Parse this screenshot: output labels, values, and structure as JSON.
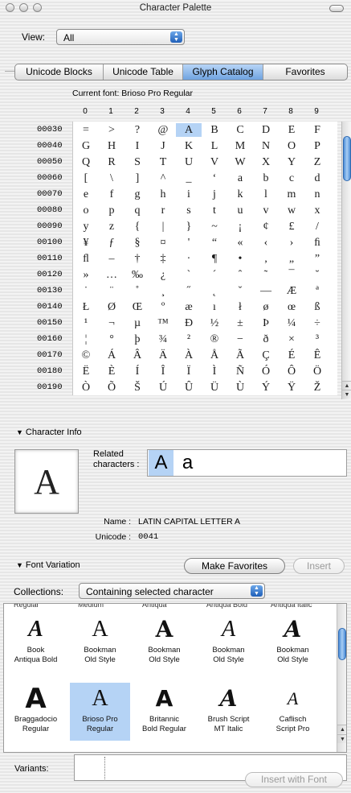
{
  "window": {
    "title": "Character Palette"
  },
  "view": {
    "label": "View:",
    "value": "All"
  },
  "tabs": [
    {
      "label": "Unicode Blocks",
      "active": false
    },
    {
      "label": "Unicode Table",
      "active": false
    },
    {
      "label": "Glyph Catalog",
      "active": true
    },
    {
      "label": "Favorites",
      "active": false
    }
  ],
  "glyph_table": {
    "current_font_label": "Current font:",
    "current_font": "Brioso Pro Regular",
    "columns": [
      "0",
      "1",
      "2",
      "3",
      "4",
      "5",
      "6",
      "7",
      "8",
      "9"
    ],
    "selected": {
      "row": 0,
      "col": 4
    },
    "rows": [
      {
        "code": "00030",
        "glyphs": [
          "=",
          ">",
          "?",
          "@",
          "A",
          "B",
          "C",
          "D",
          "E",
          "F"
        ]
      },
      {
        "code": "00040",
        "glyphs": [
          "G",
          "H",
          "I",
          "J",
          "K",
          "L",
          "M",
          "N",
          "O",
          "P"
        ]
      },
      {
        "code": "00050",
        "glyphs": [
          "Q",
          "R",
          "S",
          "T",
          "U",
          "V",
          "W",
          "X",
          "Y",
          "Z"
        ]
      },
      {
        "code": "00060",
        "glyphs": [
          "[",
          "\\",
          "]",
          "^",
          "_",
          "‘",
          "a",
          "b",
          "c",
          "d"
        ]
      },
      {
        "code": "00070",
        "glyphs": [
          "e",
          "f",
          "g",
          "h",
          "i",
          "j",
          "k",
          "l",
          "m",
          "n"
        ]
      },
      {
        "code": "00080",
        "glyphs": [
          "o",
          "p",
          "q",
          "r",
          "s",
          "t",
          "u",
          "v",
          "w",
          "x"
        ]
      },
      {
        "code": "00090",
        "glyphs": [
          "y",
          "z",
          "{",
          "|",
          "}",
          "~",
          "¡",
          "¢",
          "£",
          "/"
        ]
      },
      {
        "code": "00100",
        "glyphs": [
          "¥",
          "ƒ",
          "§",
          "¤",
          "'",
          "“",
          "«",
          "‹",
          "›",
          "ﬁ"
        ]
      },
      {
        "code": "00110",
        "glyphs": [
          "ﬂ",
          "–",
          "†",
          "‡",
          "·",
          "¶",
          "•",
          "‚",
          "„",
          "”"
        ]
      },
      {
        "code": "00120",
        "glyphs": [
          "»",
          "…",
          "‰",
          "¿",
          "`",
          "´",
          "ˆ",
          "˜",
          "¯",
          "˘"
        ]
      },
      {
        "code": "00130",
        "glyphs": [
          "˙",
          "¨",
          "˚",
          "¸",
          "˝",
          "˛",
          "ˇ",
          "—",
          "Æ",
          "ª"
        ]
      },
      {
        "code": "00140",
        "glyphs": [
          "Ł",
          "Ø",
          "Œ",
          "º",
          "æ",
          "ı",
          "ł",
          "ø",
          "œ",
          "ß"
        ]
      },
      {
        "code": "00150",
        "glyphs": [
          "¹",
          "¬",
          "µ",
          "™",
          "Ð",
          "½",
          "±",
          "Þ",
          "¼",
          "÷"
        ]
      },
      {
        "code": "00160",
        "glyphs": [
          "¦",
          "°",
          "þ",
          "¾",
          "²",
          "®",
          "−",
          "ð",
          "×",
          "³"
        ]
      },
      {
        "code": "00170",
        "glyphs": [
          "©",
          "Á",
          "Â",
          "Ä",
          "À",
          "Å",
          "Ã",
          "Ç",
          "É",
          "Ê"
        ]
      },
      {
        "code": "00180",
        "glyphs": [
          "Ë",
          "È",
          "Í",
          "Î",
          "Ï",
          "Ì",
          "Ñ",
          "Ó",
          "Ô",
          "Ö"
        ]
      },
      {
        "code": "00190",
        "glyphs": [
          "Ò",
          "Õ",
          "Š",
          "Ú",
          "Û",
          "Ü",
          "Ù",
          "Ý",
          "Ÿ",
          "Ž"
        ]
      }
    ]
  },
  "character_info": {
    "heading": "Character Info",
    "glyph": "A",
    "related_label": "Related characters :",
    "related": [
      "A",
      "a"
    ],
    "name_label": "Name :",
    "name": "LATIN CAPITAL LETTER A",
    "unicode_label": "Unicode :",
    "unicode": "0041"
  },
  "font_variation": {
    "heading": "Font Variation",
    "make_favorites": "Make Favorites",
    "insert": "Insert",
    "collections_label": "Collections:",
    "collections_value": "Containing selected character",
    "top_partial": [
      "Regular",
      "Medium",
      "Antiqua",
      "Antiqua Bold",
      "Antiqua Italic"
    ],
    "fonts": [
      {
        "glyph": "A",
        "name1": "Book",
        "name2": "Antiqua Bold",
        "selected": false
      },
      {
        "glyph": "A",
        "name1": "Bookman",
        "name2": "Old Style",
        "selected": false
      },
      {
        "glyph": "A",
        "name1": "Bookman",
        "name2": "Old Style",
        "selected": false
      },
      {
        "glyph": "A",
        "name1": "Bookman",
        "name2": "Old Style",
        "selected": false
      },
      {
        "glyph": "A",
        "name1": "Bookman",
        "name2": "Old Style",
        "selected": false
      },
      {
        "glyph": "A",
        "name1": "Braggadocio",
        "name2": "Regular",
        "selected": false
      },
      {
        "glyph": "A",
        "name1": "Brioso Pro",
        "name2": "Regular",
        "selected": true
      },
      {
        "glyph": "A",
        "name1": "Britannic",
        "name2": "Bold Regular",
        "selected": false
      },
      {
        "glyph": "A",
        "name1": "Brush Script",
        "name2": "MT Italic",
        "selected": false
      },
      {
        "glyph": "A",
        "name1": "Caflisch",
        "name2": "Script Pro",
        "selected": false
      }
    ]
  },
  "variants": {
    "label": "Variants:"
  },
  "insert_with_font": "Insert with Font",
  "colors": {
    "selection": "#b5d3f5",
    "accent": "#2f6fcf"
  }
}
